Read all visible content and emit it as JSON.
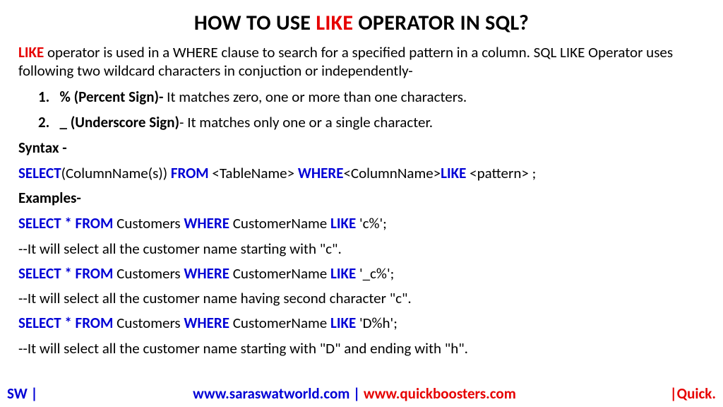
{
  "title": {
    "pre": "HOW TO USE ",
    "like": "LIKE",
    "post": " OPERATOR IN SQL?"
  },
  "intro": {
    "like": "LIKE",
    "rest": " operator is used in a WHERE clause to search for a specified pattern in a column. SQL LIKE Operator uses following two wildcard characters in conjuction or independently-"
  },
  "item1": {
    "num": "1.",
    "label": "% (Percent Sign)-",
    "desc": " It matches zero, one or more than one characters."
  },
  "item2": {
    "num": "2.",
    "label": "_ (Underscore Sign)",
    "desc": "- It matches only one or a single character."
  },
  "syntax_label": "Syntax -",
  "syntax": {
    "select": "SELECT",
    "cols": "(ColumnName(s)) ",
    "from": "FROM ",
    "table": "<TableName> ",
    "where": "WHERE",
    "col": "<ColumnName>",
    "like": "LIKE ",
    "pattern": "<pattern> ;"
  },
  "examples_label": "Examples-",
  "ex1": {
    "select": "SELECT * FROM ",
    "t": "Customers ",
    "where": "WHERE ",
    "c": "CustomerName ",
    "like": "LIKE ",
    "p": "'c%';"
  },
  "ex1_note": "--It will select all the customer name starting with \"c\".",
  "ex2": {
    "select": "SELECT * FROM ",
    "t": "Customers ",
    "where": "WHERE ",
    "c": "CustomerName ",
    "like": "LIKE ",
    "p": "'_c%';"
  },
  "ex2_note": "--It will select all the customer name having second character  \"c\".",
  "ex3": {
    "select": "SELECT * FROM ",
    "t": "Customers ",
    "where": "WHERE ",
    "c": "CustomerName ",
    "like": "LIKE ",
    "p": "'D%h';"
  },
  "ex3_note": "--It will select all the customer name starting with \"D\" and ending with \"h\".",
  "footer": {
    "left": "SW |",
    "site1": "www.saraswatworld.com",
    "sep": " | ",
    "site2": "www.quickboosters.com",
    "right": "|Quick."
  }
}
